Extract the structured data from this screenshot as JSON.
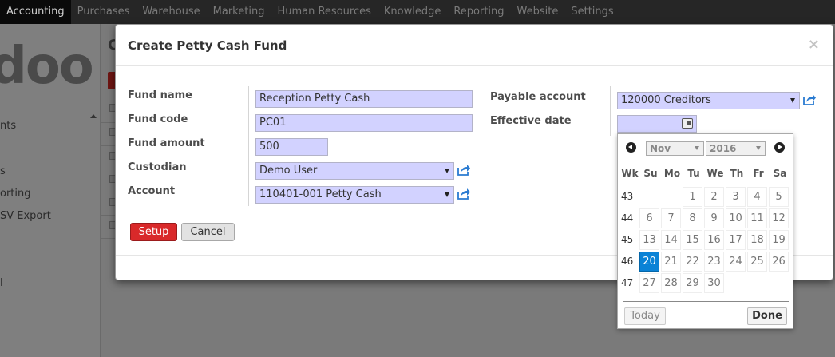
{
  "topnav": [
    "Accounting",
    "Purchases",
    "Warehouse",
    "Marketing",
    "Human Resources",
    "Knowledge",
    "Reporting",
    "Website",
    "Settings"
  ],
  "background": {
    "logo_text": "doo",
    "heading_fragment": "C",
    "sidebar_links": [
      "nts",
      "s",
      "orting",
      "SV Export",
      "l"
    ]
  },
  "modal": {
    "title": "Create Petty Cash Fund",
    "close": "×",
    "fields": {
      "fund_name": {
        "label": "Fund name",
        "value": "Reception Petty Cash"
      },
      "fund_code": {
        "label": "Fund code",
        "value": "PC01"
      },
      "fund_amount": {
        "label": "Fund amount",
        "value": "500"
      },
      "custodian": {
        "label": "Custodian",
        "value": "Demo User"
      },
      "account": {
        "label": "Account",
        "value": "110401-001 Petty Cash"
      },
      "payable_account": {
        "label": "Payable account",
        "value": "120000 Creditors"
      },
      "effective_date": {
        "label": "Effective date",
        "value": ""
      }
    },
    "buttons": {
      "setup": "Setup",
      "cancel": "Cancel"
    }
  },
  "datepicker": {
    "month": "Nov",
    "year": "2016",
    "headers": [
      "Wk",
      "Su",
      "Mo",
      "Tu",
      "We",
      "Th",
      "Fr",
      "Sa"
    ],
    "weeks": [
      {
        "wk": "43",
        "days": [
          "",
          "",
          "1",
          "2",
          "3",
          "4",
          "5"
        ]
      },
      {
        "wk": "44",
        "days": [
          "6",
          "7",
          "8",
          "9",
          "10",
          "11",
          "12"
        ]
      },
      {
        "wk": "45",
        "days": [
          "13",
          "14",
          "15",
          "16",
          "17",
          "18",
          "19"
        ]
      },
      {
        "wk": "46",
        "days": [
          "20",
          "21",
          "22",
          "23",
          "24",
          "25",
          "26"
        ]
      },
      {
        "wk": "47",
        "days": [
          "27",
          "28",
          "29",
          "30",
          "",
          "",
          ""
        ]
      }
    ],
    "selected_day": "20",
    "today_label": "Today",
    "done_label": "Done"
  },
  "colors": {
    "accent": "#d9292a",
    "selected_day": "#0a82d6",
    "required_field": "#d2d2ff",
    "topbar": "#262626"
  }
}
